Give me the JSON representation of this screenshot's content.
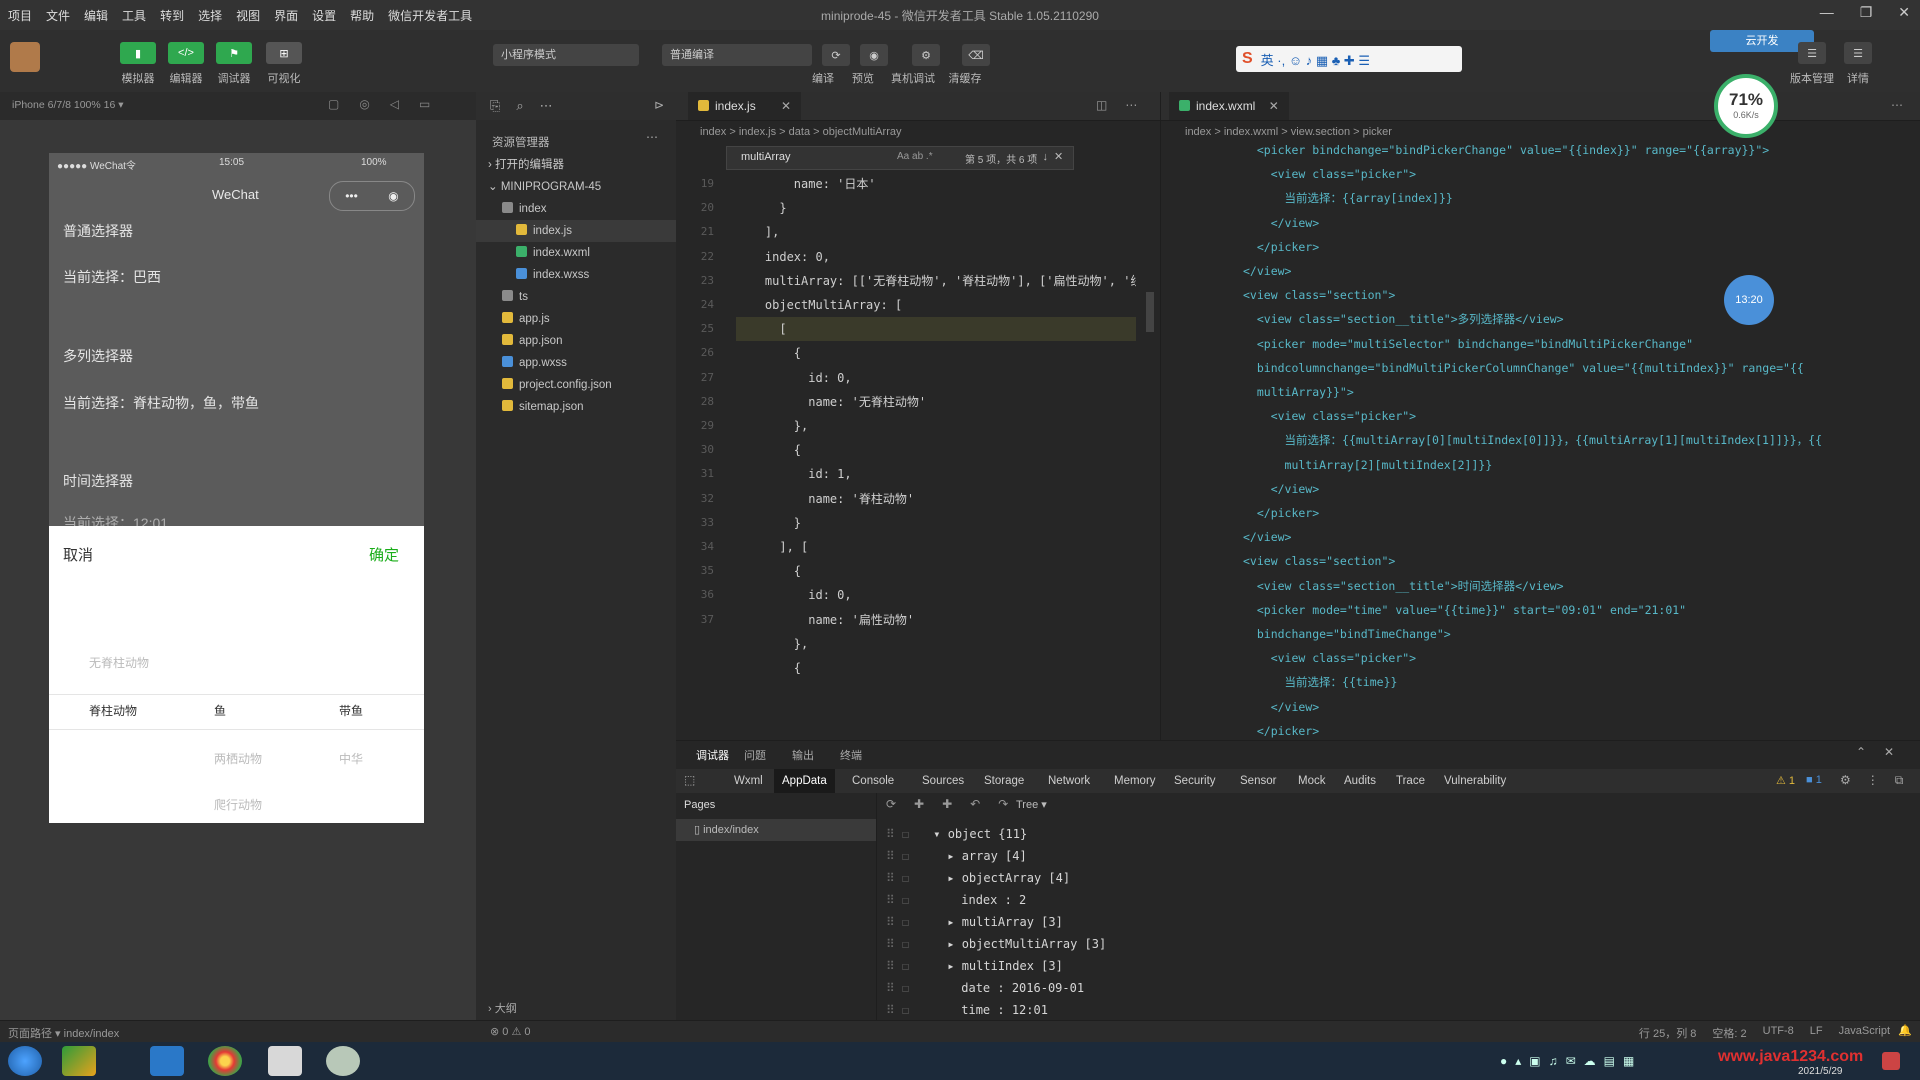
{
  "window": {
    "title": "miniprode-45 - 微信开发者工具 Stable 1.05.2110290",
    "menu": [
      "项目",
      "文件",
      "编辑",
      "工具",
      "转到",
      "选择",
      "视图",
      "界面",
      "设置",
      "帮助",
      "微信开发者工具"
    ]
  },
  "toolbar": {
    "buttons": [
      {
        "label": "模拟器",
        "icon": "phone-icon",
        "color": "#2fa84f"
      },
      {
        "label": "编辑器",
        "icon": "code-icon",
        "color": "#2fa84f"
      },
      {
        "label": "调试器",
        "icon": "debug-icon",
        "color": "#2fa84f"
      },
      {
        "label": "可视化",
        "icon": "layout-icon",
        "color": "#555555"
      }
    ],
    "mode_select": "小程序模式",
    "compile_select": "普通编译",
    "actions": [
      "编译",
      "预览",
      "真机调试",
      "清缓存"
    ],
    "right_actions": [
      "版本管理",
      "详情"
    ],
    "cloud_label": "云开发",
    "perf_percent": "71%",
    "perf_sub": "0.6K/s"
  },
  "simulator": {
    "device": "iPhone 6/7/8 100% 16 ▾",
    "status_left": "●●●●● WeChat令",
    "status_time": "15:05",
    "status_right": "100%",
    "nav_title": "WeChat",
    "texts": [
      "普通选择器",
      "当前选择：巴西",
      "多列选择器",
      "当前选择：脊柱动物，鱼，带鱼",
      "时间选择器",
      "当前选择：12:01"
    ],
    "picker": {
      "cancel": "取消",
      "confirm": "确定",
      "rows": [
        [
          "无脊柱动物",
          "",
          ""
        ],
        [
          "脊柱动物",
          "鱼",
          "带鱼"
        ],
        [
          "",
          "两栖动物",
          "中华"
        ],
        [
          "",
          "爬行动物",
          ""
        ]
      ]
    }
  },
  "explorer": {
    "title": "资源管理器",
    "sections": [
      "打开的编辑器",
      "MINIPROGRAM-45"
    ],
    "items": [
      {
        "name": "index",
        "type": "folder",
        "depth": 1
      },
      {
        "name": "index.js",
        "type": "js",
        "depth": 2,
        "selected": true
      },
      {
        "name": "index.wxml",
        "type": "wxml",
        "depth": 2
      },
      {
        "name": "index.wxss",
        "type": "wxss",
        "depth": 2
      },
      {
        "name": "ts",
        "type": "folder",
        "depth": 1
      },
      {
        "name": "app.js",
        "type": "js",
        "depth": 1
      },
      {
        "name": "app.json",
        "type": "json",
        "depth": 1
      },
      {
        "name": "app.wxss",
        "type": "wxss",
        "depth": 1
      },
      {
        "name": "project.config.json",
        "type": "json",
        "depth": 1
      },
      {
        "name": "sitemap.json",
        "type": "json",
        "depth": 1
      }
    ],
    "outline": "大纲",
    "status": "⊗ 0 ⚠ 0"
  },
  "editor_left": {
    "tab": "index.js",
    "breadcrumb": "index > index.js > data > objectMultiArray",
    "find_value": "multiArray",
    "find_result": "第 5 项，共 6 项",
    "lines": [
      "        name: '日本'",
      "      }",
      "    ],",
      "    index: 0,",
      "    multiArray: [['无脊柱动物', '脊柱动物'], ['扁性动物', '线形动物', '环节动物', '软体动物', '节肢动物'], ['猪肉绦虫', '吸血虫']],",
      "    objectMultiArray: [",
      "      [",
      "        {",
      "          id: 0,",
      "          name: '无脊柱动物'",
      "        },",
      "        {",
      "          id: 1,",
      "          name: '脊柱动物'",
      "        }",
      "      ], [",
      "        {",
      "          id: 0,",
      "          name: '扁性动物'",
      "        },",
      "        {"
    ],
    "line_numbers": [
      "19",
      "20",
      "21",
      "22",
      "23",
      "",
      "",
      "24",
      "25",
      "26",
      "27",
      "28",
      "29",
      "30",
      "31",
      "32",
      "33",
      "34",
      "35",
      "36",
      "37"
    ]
  },
  "editor_right": {
    "tab": "index.wxml",
    "breadcrumb": "index > index.wxml > view.section > picker",
    "lines": [
      "  <picker bindchange=\"bindPickerChange\" value=\"{{index}}\" range=\"{{array}}\">",
      "    <view class=\"picker\">",
      "      当前选择：{{array[index]}}",
      "    </view>",
      "  </picker>",
      "</view>",
      "<view class=\"section\">",
      "  <view class=\"section__title\">多列选择器</view>",
      "  <picker mode=\"multiSelector\" bindchange=\"bindMultiPickerChange\"",
      "  bindcolumnchange=\"bindMultiPickerColumnChange\" value=\"{{multiIndex}}\" range=\"{{",
      "  multiArray}}\">",
      "    <view class=\"picker\">",
      "      当前选择：{{multiArray[0][multiIndex[0]]}}，{{multiArray[1][multiIndex[1]]}}，{{",
      "      multiArray[2][multiIndex[2]]}}",
      "    </view>",
      "  </picker>",
      "</view>",
      "<view class=\"section\">",
      "  <view class=\"section__title\">时间选择器</view>",
      "  <picker mode=\"time\" value=\"{{time}}\" start=\"09:01\" end=\"21:01\"",
      "  bindchange=\"bindTimeChange\">",
      "    <view class=\"picker\">",
      "      当前选择：{{time}}",
      "    </view>",
      "  </picker>"
    ],
    "time_badge": "13:20"
  },
  "devtools": {
    "top_tabs": [
      "调试器",
      "问题",
      "输出",
      "终端"
    ],
    "tabs": [
      "Wxml",
      "AppData",
      "Console",
      "Sources",
      "Storage",
      "Network",
      "Memory",
      "Security",
      "Sensor",
      "Mock",
      "Audits",
      "Trace",
      "Vulnerability"
    ],
    "active_tab": "AppData",
    "warnings": "⚠ 1",
    "errors": "■ 1",
    "pages_label": "Pages",
    "page_item": "index/index",
    "view_mode": "Tree",
    "object_rows": [
      {
        "text": "▾ object {11}",
        "indent": 0
      },
      {
        "text": "▸ array [4]",
        "indent": 1
      },
      {
        "text": "▸ objectArray [4]",
        "indent": 1
      },
      {
        "text": "index : 2",
        "indent": 2
      },
      {
        "text": "▸ multiArray [3]",
        "indent": 1
      },
      {
        "text": "▸ objectMultiArray [3]",
        "indent": 1
      },
      {
        "text": "▸ multiIndex [3]",
        "indent": 1
      },
      {
        "text": "date : 2016-09-01",
        "indent": 2
      },
      {
        "text": "time : 12:01",
        "indent": 2
      }
    ]
  },
  "statusbar": {
    "left": "页面路径 ▾   index/index",
    "right": [
      "行 25，列 8",
      "空格: 2",
      "UTF-8",
      "LF",
      "JavaScript"
    ]
  },
  "taskbar": {
    "clock": "2021/5/29",
    "watermark": "www.java1234.com"
  }
}
